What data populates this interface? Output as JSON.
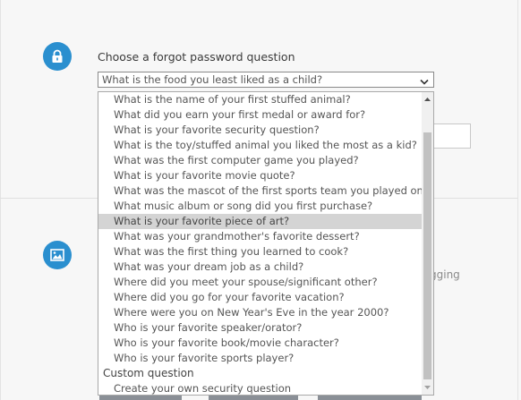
{
  "form": {
    "question_label": "Choose a forgot password question",
    "selected_question": "What is the food you least liked as a child?",
    "partial_text": "gging"
  },
  "dropdown": {
    "options": [
      "What is the name of your first stuffed animal?",
      "What did you earn your first medal or award for?",
      "What is your favorite security question?",
      "What is the toy/stuffed animal you liked the most as a kid?",
      "What was the first computer game you played?",
      "What is your favorite movie quote?",
      "What was the mascot of the first sports team you played on?",
      "What music album or song did you first purchase?",
      "What is your favorite piece of art?",
      "What was your grandmother's favorite dessert?",
      "What was the first thing you learned to cook?",
      "What was your dream job as a child?",
      "Where did you meet your spouse/significant other?",
      "Where did you go for your favorite vacation?",
      "Where were you on New Year's Eve in the year 2000?",
      "Who is your favorite speaker/orator?",
      "Who is your favorite book/movie character?",
      "Who is your favorite sports player?"
    ],
    "highlighted_option": "What is your favorite piece of art?",
    "custom_group_label": "Custom question",
    "custom_options": [
      "Create your own security question"
    ]
  },
  "icons": {
    "lock": "lock-icon",
    "image": "image-icon",
    "accent_color": "#2a8fcf"
  }
}
